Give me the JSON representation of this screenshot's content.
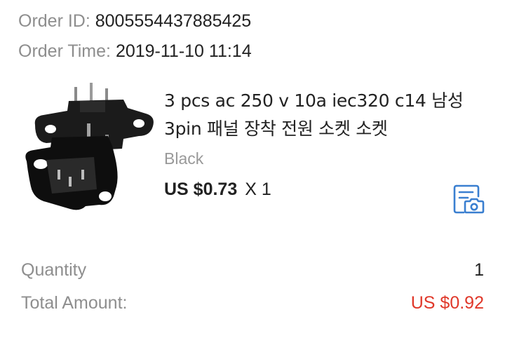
{
  "order": {
    "id_label": "Order ID:",
    "id_value": "8005554437885425",
    "time_label": "Order Time:",
    "time_value": "2019-11-10 11:14"
  },
  "product": {
    "title": "3 pcs ac 250 v 10a iec320 c14 남성 3pin 패널 장착 전원 소켓 소켓",
    "variant": "Black",
    "price": "US $0.73",
    "quantity_text": "X 1",
    "image_icon": "ac-power-socket-product-photo",
    "snapshot_icon": "order-snapshot-camera-icon"
  },
  "summary": {
    "quantity_label": "Quantity",
    "quantity_value": "1",
    "total_label": "Total Amount:",
    "total_value": "US $0.92"
  },
  "colors": {
    "label_gray": "#8e8e8e",
    "text_dark": "#222222",
    "price_red": "#e0382a",
    "icon_blue": "#3a7fd0"
  }
}
